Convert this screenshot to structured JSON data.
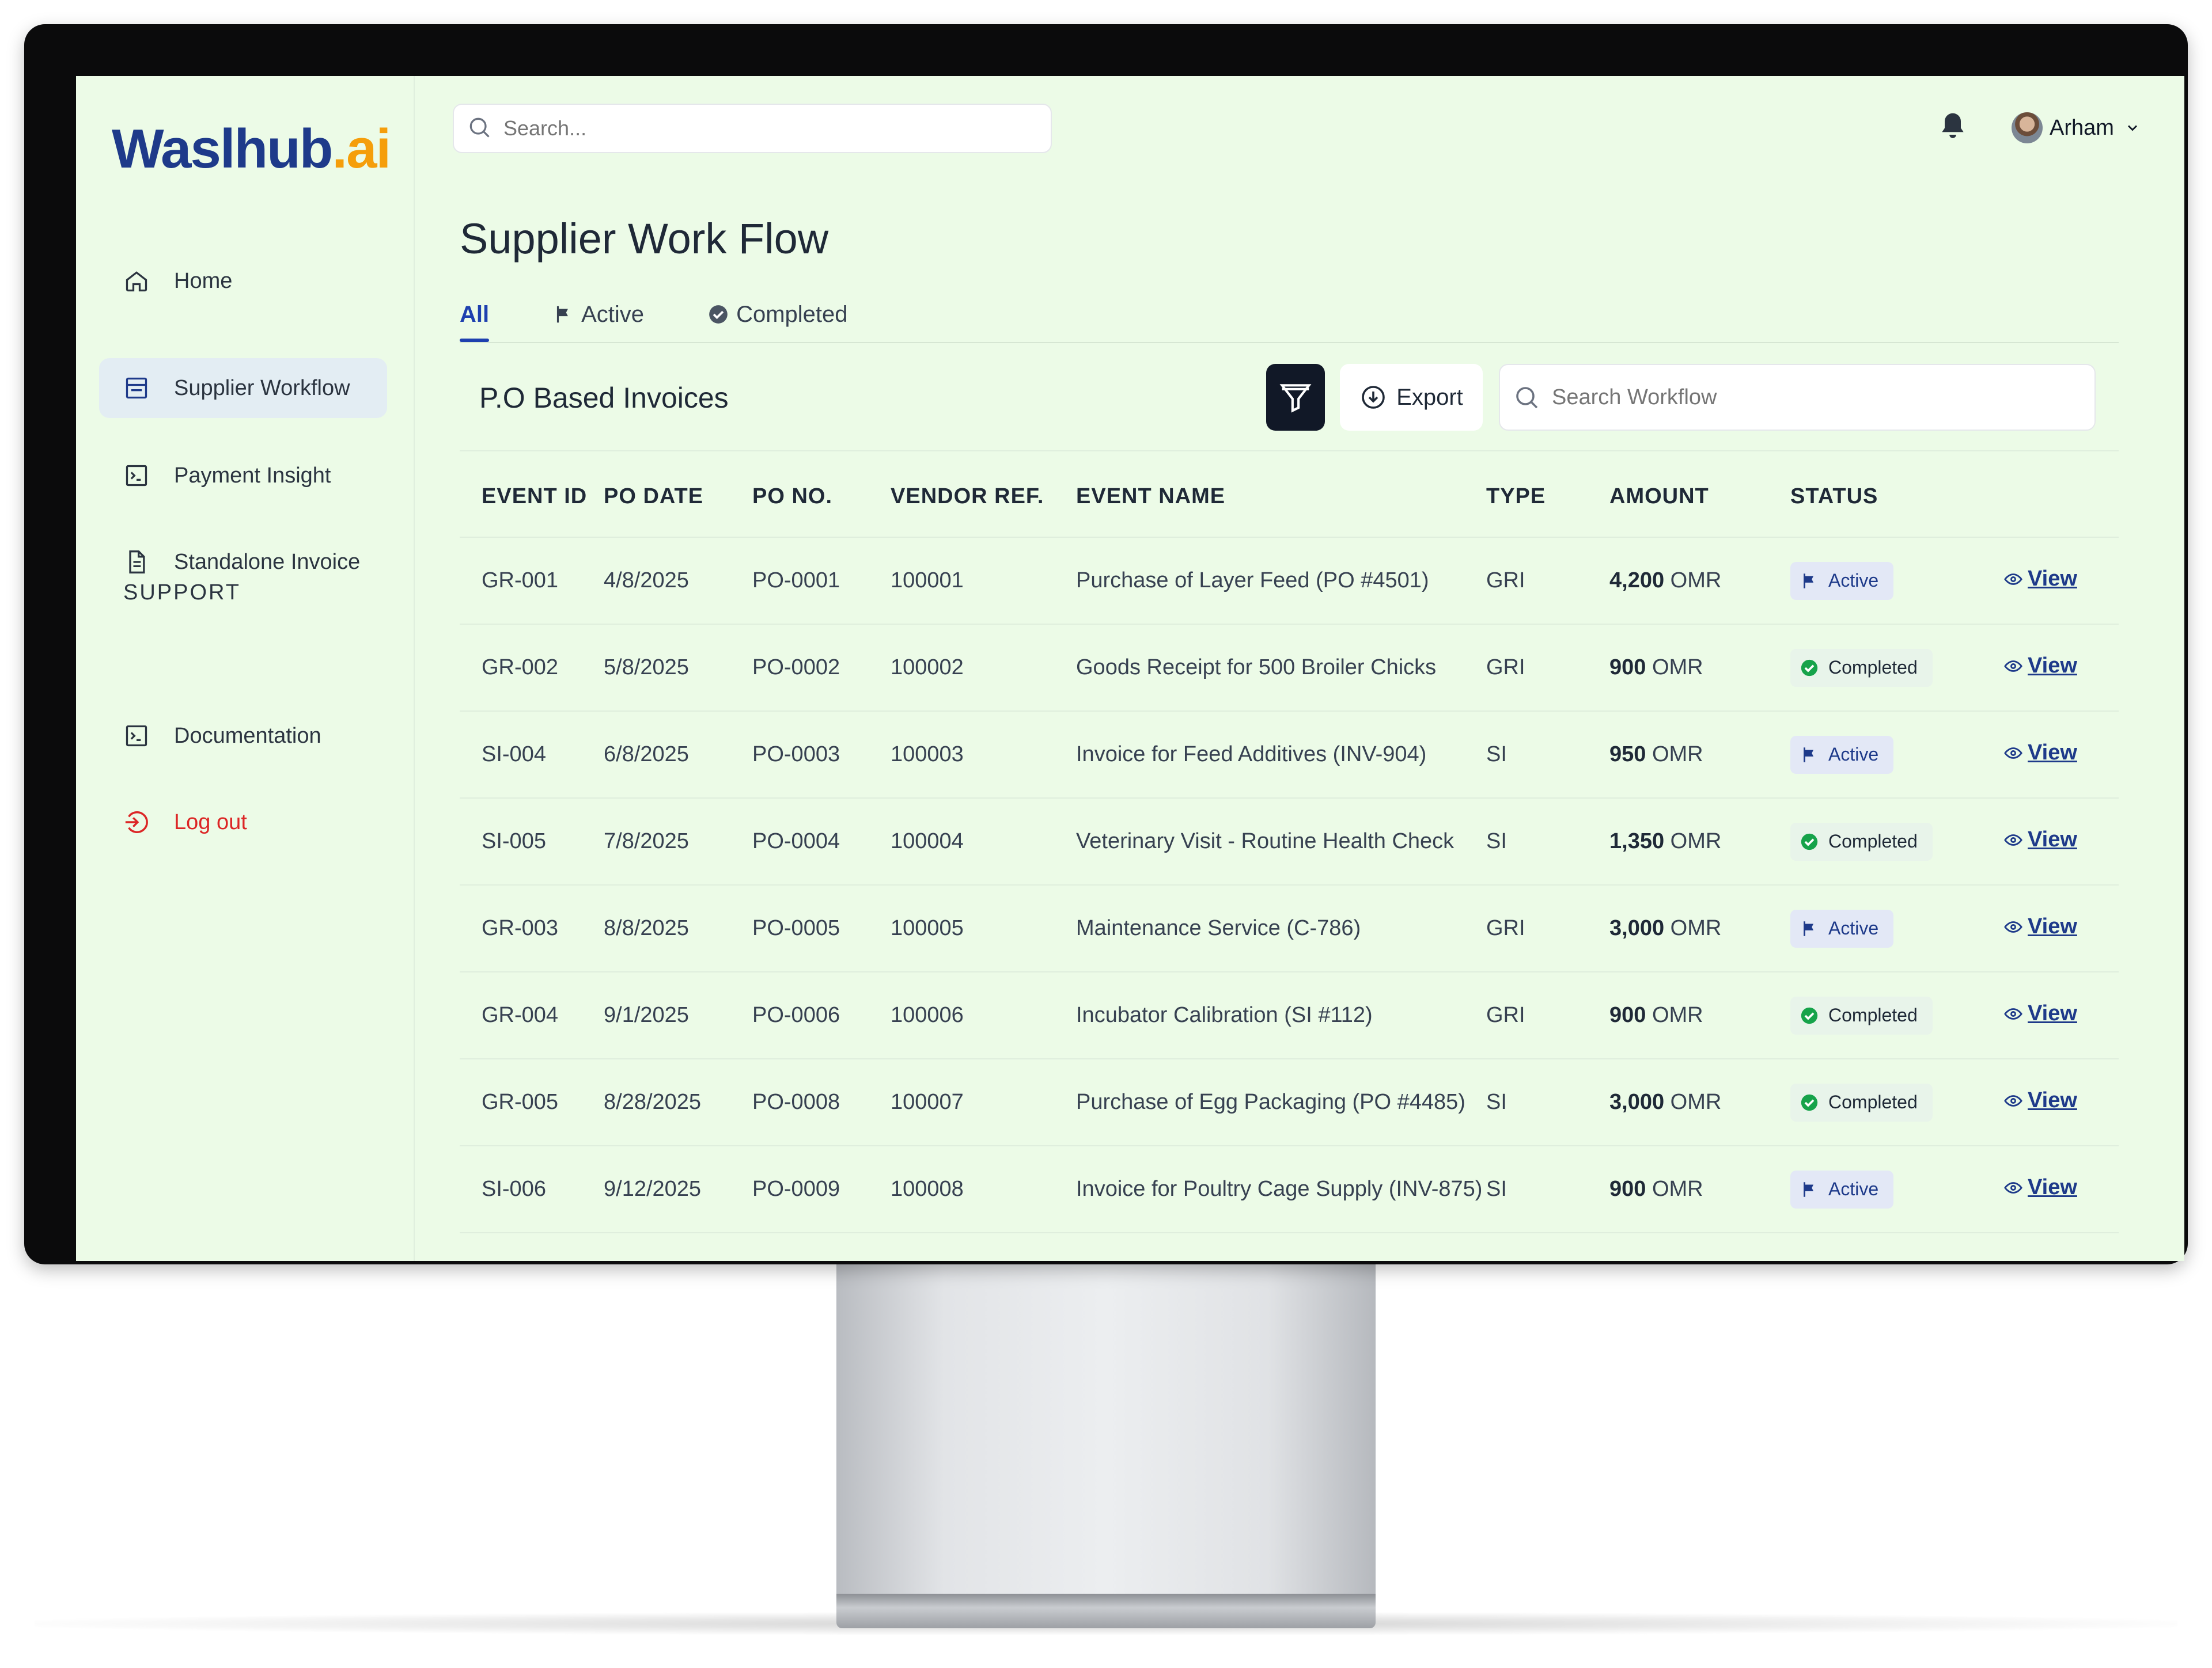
{
  "brand": {
    "logo_main": "Waslhub",
    "logo_suffix": ".ai"
  },
  "sidebar": {
    "items": [
      {
        "label": "Home",
        "icon": "home-icon"
      },
      {
        "label": "Supplier Workflow",
        "icon": "workflow-icon"
      },
      {
        "label": "Payment Insight",
        "icon": "terminal-icon"
      },
      {
        "label": "Standalone Invoice",
        "icon": "document-icon"
      }
    ],
    "support_label": "SUPPORT",
    "support_items": [
      {
        "label": "Documentation",
        "icon": "terminal-icon"
      },
      {
        "label": "Log out",
        "icon": "logout-icon"
      }
    ]
  },
  "topbar": {
    "search_placeholder": "Search...",
    "user_name": "Arham"
  },
  "page": {
    "title": "Supplier Work Flow",
    "tabs": [
      {
        "label": "All"
      },
      {
        "label": "Active"
      },
      {
        "label": "Completed"
      }
    ],
    "section_title": "P.O Based Invoices",
    "export_label": "Export",
    "workflow_search_placeholder": "Search Workflow"
  },
  "table": {
    "headers": [
      "EVENT ID",
      "PO DATE",
      "PO NO.",
      "VENDOR REF.",
      "EVENT NAME",
      "TYPE",
      "AMOUNT",
      "STATUS"
    ],
    "currency": "OMR",
    "view_label": "View",
    "rows": [
      {
        "event_id": "GR-001",
        "po_date": "4/8/2025",
        "po_no": "PO-0001",
        "vendor_ref": "100001",
        "event_name": "Purchase of Layer Feed (PO #4501)",
        "type": "GRI",
        "amount": "4,200",
        "status": "Active"
      },
      {
        "event_id": "GR-002",
        "po_date": "5/8/2025",
        "po_no": "PO-0002",
        "vendor_ref": "100002",
        "event_name": "Goods Receipt for 500 Broiler Chicks",
        "type": "GRI",
        "amount": "900",
        "status": "Completed"
      },
      {
        "event_id": "SI-004",
        "po_date": "6/8/2025",
        "po_no": "PO-0003",
        "vendor_ref": "100003",
        "event_name": "Invoice for Feed Additives (INV-904)",
        "type": "SI",
        "amount": "950",
        "status": "Active"
      },
      {
        "event_id": "SI-005",
        "po_date": "7/8/2025",
        "po_no": "PO-0004",
        "vendor_ref": "100004",
        "event_name": "Veterinary Visit - Routine Health Check",
        "type": "SI",
        "amount": "1,350",
        "status": "Completed"
      },
      {
        "event_id": "GR-003",
        "po_date": "8/8/2025",
        "po_no": "PO-0005",
        "vendor_ref": "100005",
        "event_name": "Maintenance Service  (C-786)",
        "type": "GRI",
        "amount": "3,000",
        "status": "Active"
      },
      {
        "event_id": "GR-004",
        "po_date": "9/1/2025",
        "po_no": "PO-0006",
        "vendor_ref": "100006",
        "event_name": "Incubator Calibration (SI #112)",
        "type": "GRI",
        "amount": "900",
        "status": "Completed"
      },
      {
        "event_id": "GR-005",
        "po_date": "8/28/2025",
        "po_no": "PO-0008",
        "vendor_ref": "100007",
        "event_name": "Purchase of Egg Packaging (PO #4485)",
        "type": "SI",
        "amount": "3,000",
        "status": "Completed"
      },
      {
        "event_id": "SI-006",
        "po_date": "9/12/2025",
        "po_no": "PO-0009",
        "vendor_ref": "100008",
        "event_name": "Invoice for Poultry Cage Supply (INV-875)",
        "type": "SI",
        "amount": "900",
        "status": "Active"
      }
    ]
  },
  "colors": {
    "screen_bg": "#ecfbe7",
    "accent": "#1e3a8a",
    "logo_orange": "#f59e0b",
    "logout_red": "#dc2626",
    "completed_green": "#16a34a"
  }
}
